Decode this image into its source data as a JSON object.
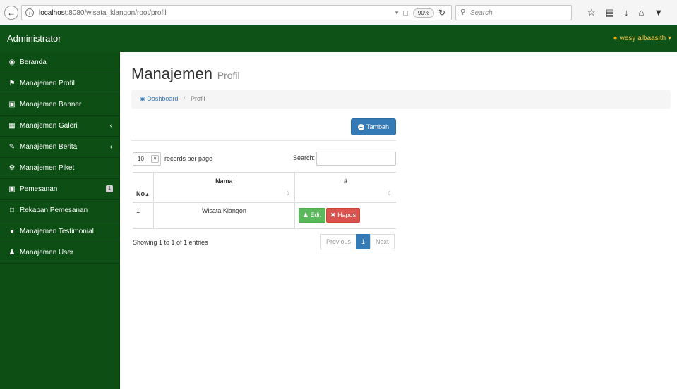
{
  "browser": {
    "url_host": "localhost",
    "url_rest": ":8080/wisata_klangon/root/profil",
    "zoom": "90%",
    "search_placeholder": "Search"
  },
  "navbar": {
    "brand": "Administrator",
    "user": "wesy albaasith"
  },
  "sidebar": {
    "items": [
      {
        "label": "Beranda",
        "icon": "dashboard-icon"
      },
      {
        "label": "Manajemen Profil",
        "icon": "flag-icon"
      },
      {
        "label": "Manajemen Banner",
        "icon": "desktop-icon"
      },
      {
        "label": "Manajemen Galeri",
        "icon": "image-icon"
      },
      {
        "label": "Manajemen Berita",
        "icon": "pencil-icon"
      },
      {
        "label": "Manajemen Piket",
        "icon": "cogs-icon"
      },
      {
        "label": "Pemesanan",
        "icon": "cart-icon",
        "badge": "1"
      },
      {
        "label": "Rekapan Pemesanan",
        "icon": "file-icon"
      },
      {
        "label": "Manajemen Testimonial",
        "icon": "comments-icon"
      },
      {
        "label": "Manajemen User",
        "icon": "users-icon"
      }
    ]
  },
  "page": {
    "title": "Manajemen",
    "subtitle": "Profil",
    "breadcrumb": {
      "home": "Dashboard",
      "current": "Profil"
    },
    "add_button": "Tambah"
  },
  "table": {
    "length_value": "10",
    "length_label": "records per page",
    "search_label": "Search:",
    "headers": {
      "no": "No",
      "nama": "Nama",
      "action": "#"
    },
    "rows": [
      {
        "no": "1",
        "nama": "Wisata Klangon",
        "edit": "Edit",
        "hapus": "Hapus"
      }
    ],
    "info": "Showing 1 to 1 of 1 entries",
    "pager": {
      "prev": "Previous",
      "page": "1",
      "next": "Next"
    }
  },
  "colors": {
    "navbar": "#0f5218",
    "sidebar": "#0c4e14",
    "primary": "#337ab7",
    "success": "#5cb85c",
    "danger": "#d9534f"
  }
}
